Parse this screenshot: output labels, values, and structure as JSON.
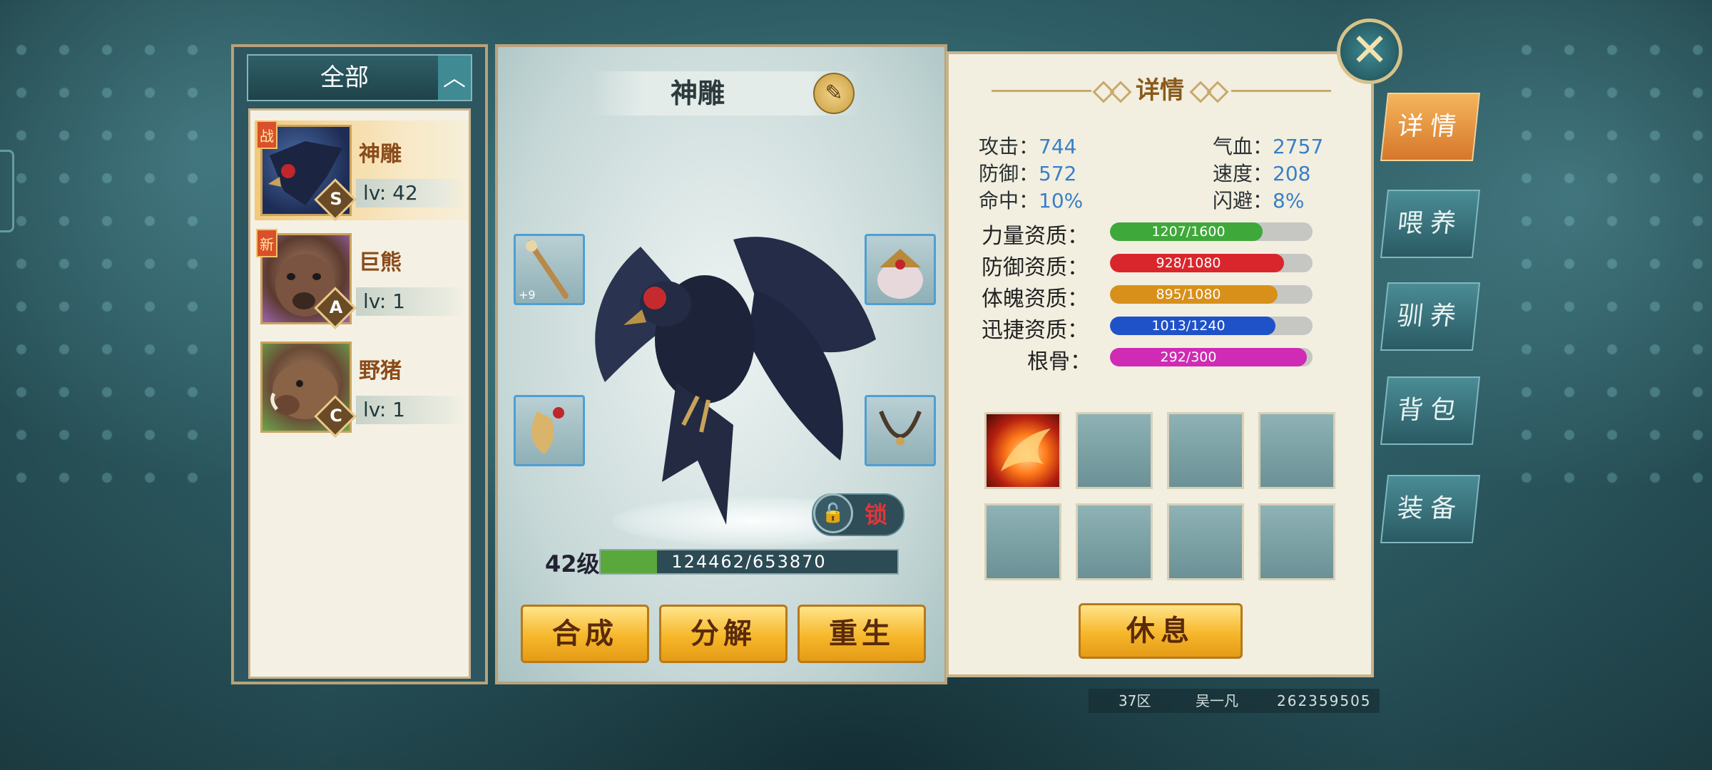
{
  "list_panel": {
    "filter_label": "全部",
    "collapse_icon": "chevron-up-icon",
    "pets": [
      {
        "name": "神雕",
        "level": "lv: 42",
        "grade": "S",
        "tag": "战",
        "selected": true
      },
      {
        "name": "巨熊",
        "level": "lv: 1",
        "grade": "A",
        "tag": "新",
        "selected": false
      },
      {
        "name": "野猪",
        "level": "lv: 1",
        "grade": "C",
        "tag": "",
        "selected": false
      }
    ]
  },
  "pet_view": {
    "name": "神雕",
    "lock_label": "锁",
    "level_label": "42级",
    "exp_text": "124462/653870",
    "exp_current": 124462,
    "exp_max": 653870,
    "equip_plus": "+9",
    "actions": [
      "合成",
      "分解",
      "重生"
    ]
  },
  "detail": {
    "title": "详情",
    "stats": {
      "attack_label": "攻击：",
      "attack": "744",
      "hp_label": "气血：",
      "hp": "2757",
      "defense_label": "防御：",
      "defense": "572",
      "speed_label": "速度：",
      "speed": "208",
      "hit_label": "命中：",
      "hit": "10%",
      "dodge_label": "闪避：",
      "dodge": "8%"
    },
    "aptitudes": [
      {
        "label": "力量资质：",
        "text": "1207/1600",
        "value": 1207,
        "max": 1600,
        "color": "#3fa83a"
      },
      {
        "label": "防御资质：",
        "text": "928/1080",
        "value": 928,
        "max": 1080,
        "color": "#d8262c"
      },
      {
        "label": "体魄资质：",
        "text": "895/1080",
        "value": 895,
        "max": 1080,
        "color": "#d8901a"
      },
      {
        "label": "迅捷资质：",
        "text": "1013/1240",
        "value": 1013,
        "max": 1240,
        "color": "#1f52c9"
      },
      {
        "label": "根骨：",
        "text": "292/300",
        "value": 292,
        "max": 300,
        "color": "#cf2bb5"
      }
    ],
    "rest_label": "休息"
  },
  "side_tabs": [
    "详情",
    "喂养",
    "驯养",
    "背包",
    "装备"
  ],
  "footer": {
    "server": "37区",
    "player": "吴一凡",
    "id": "262359505"
  },
  "colors": {
    "accent_gold": "#f6b72a",
    "panel_teal": "#2d5660",
    "active_tab": "#e08a35"
  }
}
